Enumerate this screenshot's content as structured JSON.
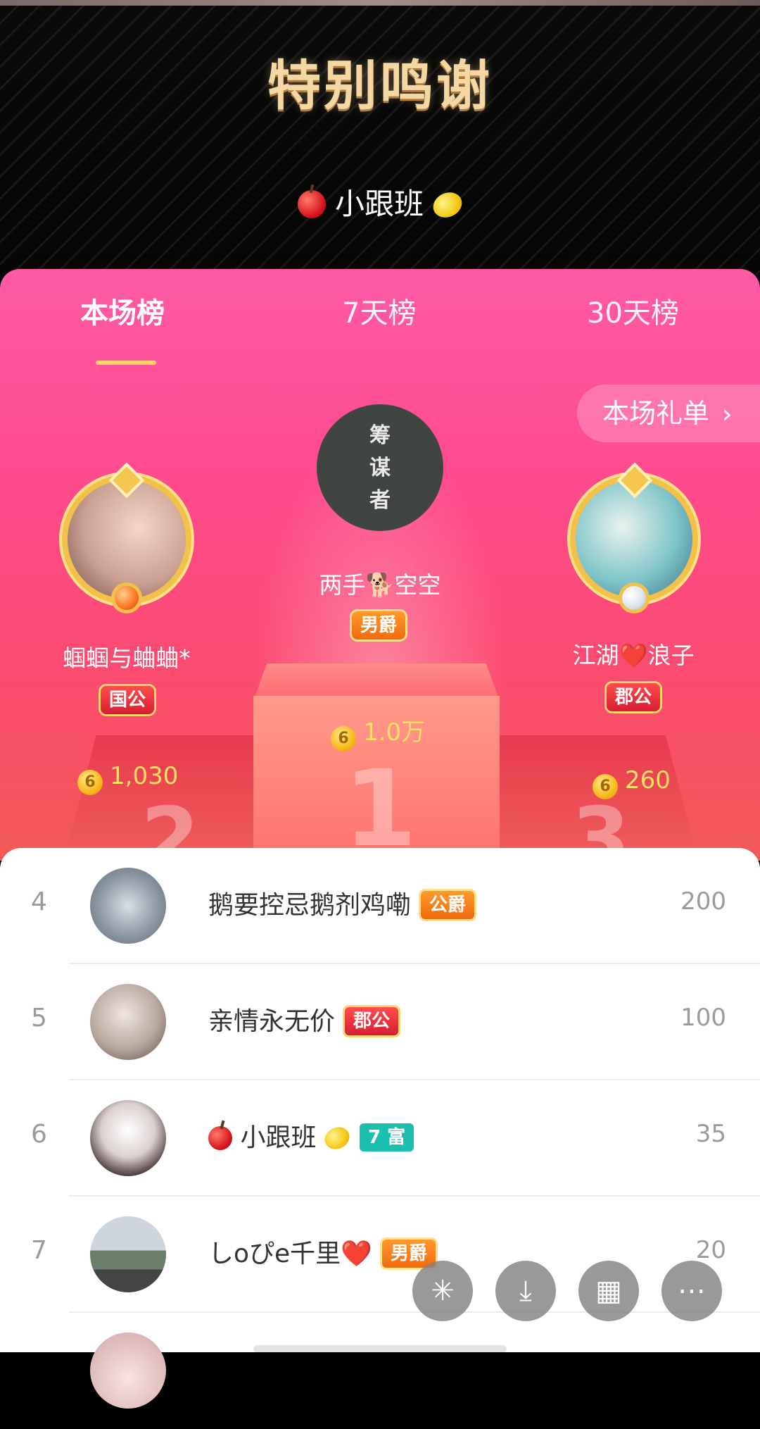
{
  "header": {
    "title": "特别鸣谢",
    "subtitle_name": "小跟班"
  },
  "tabs": [
    {
      "label": "本场榜",
      "active": true
    },
    {
      "label": "7天榜",
      "active": false
    },
    {
      "label": "30天榜",
      "active": false
    }
  ],
  "gift_list_button": {
    "label": "本场礼单"
  },
  "top3": {
    "first": {
      "rank": "1",
      "avatar_text": [
        "筹",
        "谋",
        "者"
      ],
      "name": "两手🐕空空",
      "badge": "男爵",
      "score": "1.0万"
    },
    "second": {
      "rank": "2",
      "name": "蝈蝈与蛐蛐*",
      "badge": "国公",
      "score": "1,030"
    },
    "third": {
      "rank": "3",
      "name": "江湖❤️浪子",
      "badge": "郡公",
      "score": "260"
    }
  },
  "list": [
    {
      "rank": "4",
      "name": "鹅要控忌鹅剂鸡嘞",
      "tag": "公爵",
      "tag_style": "orange",
      "value": "200"
    },
    {
      "rank": "5",
      "name": "亲情永无价",
      "tag": "郡公",
      "tag_style": "red",
      "value": "100"
    },
    {
      "rank": "6",
      "name": "小跟班",
      "tag": "7 富",
      "tag_style": "teal",
      "value": "35"
    },
    {
      "rank": "7",
      "name": "しoぴe千里❤️",
      "tag": "男爵",
      "tag_style": "orange",
      "value": "20"
    }
  ],
  "coin_symbol": "6",
  "fab_icons": [
    "sparkle-icon",
    "download-icon",
    "grid-icon",
    "more-icon"
  ]
}
